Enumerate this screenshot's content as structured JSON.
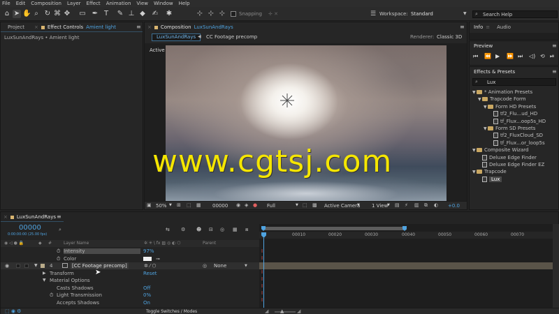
{
  "menu": [
    "File",
    "Edit",
    "Composition",
    "Layer",
    "Effect",
    "Animation",
    "View",
    "Window",
    "Help"
  ],
  "toolbar": {
    "snapping_label": "Snapping",
    "workspace_label": "Workspace:",
    "workspace_value": "Standard",
    "search_help": "Search Help"
  },
  "left_panel": {
    "project_tab": "Project",
    "effect_controls_tab": "Effect Controls",
    "effect_controls_target": "Amient light",
    "breadcrumb": "LuxSunAndRays • Amient light"
  },
  "composition": {
    "tab_label": "Composition",
    "tab_name": "LuxSunAndRays",
    "chip_current": "LuxSunAndRays",
    "chip_next": "CC Footage precomp",
    "renderer_label": "Renderer:",
    "renderer_value": "Classic 3D",
    "view_label": "Active Camera",
    "footer": {
      "zoom": "50%",
      "timecode": "00000",
      "resolution": "Full",
      "camera": "Active Camera",
      "views": "1 View",
      "exposure": "+0.0"
    }
  },
  "watermark": "www.cgtsj.com",
  "info_panel": {
    "tab_info": "Info",
    "tab_audio": "Audio"
  },
  "preview_panel": {
    "title": "Preview"
  },
  "effects_presets": {
    "title": "Effects & Presets",
    "search_value": "Lux",
    "tree": [
      {
        "label": "* Animation Presets",
        "level": 0,
        "kind": "folder",
        "open": true
      },
      {
        "label": "Trapcode Form",
        "level": 1,
        "kind": "folder",
        "open": true
      },
      {
        "label": "Form HD Presets",
        "level": 2,
        "kind": "folder",
        "open": true
      },
      {
        "label": "tf2_Flu...ud_HD",
        "level": 3,
        "kind": "file"
      },
      {
        "label": "tf_Flux...oop5s_HD",
        "level": 3,
        "kind": "file"
      },
      {
        "label": "Form SD Presets",
        "level": 2,
        "kind": "folder",
        "open": true
      },
      {
        "label": "tf2_FluxCloud_SD",
        "level": 3,
        "kind": "file"
      },
      {
        "label": "tf_Flux...or_loop5s",
        "level": 3,
        "kind": "file"
      },
      {
        "label": "Composite Wizard",
        "level": 0,
        "kind": "folder",
        "open": true
      },
      {
        "label": "Deluxe Edge Finder",
        "level": 1,
        "kind": "file"
      },
      {
        "label": "Deluxe Edge Finder EZ",
        "level": 1,
        "kind": "file"
      },
      {
        "label": "Trapcode",
        "level": 0,
        "kind": "folder",
        "open": true
      },
      {
        "label": "Lux",
        "level": 1,
        "kind": "file",
        "selected": true
      }
    ]
  },
  "timeline": {
    "tab_label": "LuxSunAndRays",
    "timecode": "00000",
    "timecode_sub": "0:00:00:00 (25.00 fps)",
    "search_placeholder": "",
    "col_layer_name": "Layer Name",
    "col_parent": "Parent",
    "ruler": [
      "0",
      "00010",
      "00020",
      "00030",
      "00040",
      "00050",
      "00060",
      "00070"
    ],
    "rows": [
      {
        "label": "Intensity",
        "value": "97%",
        "indent": 90,
        "stopwatch": true,
        "highlight": true
      },
      {
        "label": "Color",
        "value": "",
        "indent": 90,
        "stopwatch": true,
        "swatch": true
      },
      {
        "label": "[CC Footage precomp]",
        "num": "4",
        "indent": 100,
        "layer": true,
        "parent": "None"
      },
      {
        "label": "Transform",
        "value": "Reset",
        "indent": 70,
        "fold": "▶"
      },
      {
        "label": "Material Options",
        "value": "",
        "indent": 70,
        "fold": "▼"
      },
      {
        "label": "Casts Shadows",
        "value": "Off",
        "indent": 80
      },
      {
        "label": "Light Transmission",
        "value": "0%",
        "indent": 80,
        "stopwatch": true
      },
      {
        "label": "Accepts Shadows",
        "value": "On",
        "indent": 80
      }
    ],
    "toggle_label": "Toggle Switches / Modes"
  },
  "colors": {
    "accent_blue": "#4fa3e0",
    "watermark_yellow": "#f5e600",
    "folder": "#c9a762"
  }
}
